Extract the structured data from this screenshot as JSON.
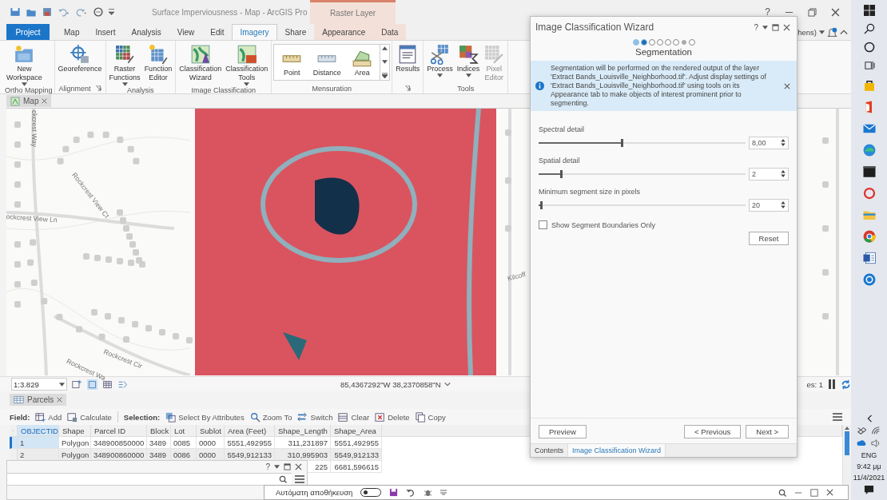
{
  "window": {
    "title": "Surface Imperviousness - Map - ArcGIS Pro",
    "context_title": "Raster Layer",
    "help": "?"
  },
  "ribbon_tabs": [
    {
      "label": "Project",
      "kind": "backstage",
      "selected": false
    },
    {
      "label": "Map",
      "kind": "core",
      "selected": false
    },
    {
      "label": "Insert",
      "kind": "core",
      "selected": false
    },
    {
      "label": "Analysis",
      "kind": "core",
      "selected": false
    },
    {
      "label": "View",
      "kind": "core",
      "selected": false
    },
    {
      "label": "Edit",
      "kind": "core",
      "selected": false
    },
    {
      "label": "Imagery",
      "kind": "core",
      "selected": true
    },
    {
      "label": "Share",
      "kind": "core",
      "selected": false
    },
    {
      "label": "Appearance",
      "kind": "contextual",
      "selected": false
    },
    {
      "label": "Data",
      "kind": "contextual",
      "selected": false
    }
  ],
  "account": {
    "text": "hens)"
  },
  "ribbon_groups": [
    {
      "label": "Ortho Mapping",
      "kind": "plain",
      "launcher": false,
      "buttons": [
        {
          "label": "New\nWorkspace",
          "dropdown": true,
          "disabled": false
        }
      ]
    },
    {
      "label": "Alignment",
      "kind": "plain",
      "launcher": true,
      "buttons": [
        {
          "label": "Georeference",
          "dropdown": false,
          "disabled": false
        }
      ]
    },
    {
      "label": "Analysis",
      "kind": "plain",
      "launcher": false,
      "buttons": [
        {
          "label": "Raster\nFunctions",
          "dropdown": true,
          "disabled": false
        },
        {
          "label": "Function\nEditor",
          "dropdown": false,
          "disabled": false
        }
      ]
    },
    {
      "label": "Image Classification",
      "kind": "plain",
      "launcher": false,
      "buttons": [
        {
          "label": "Classification\nWizard",
          "dropdown": false,
          "disabled": false
        },
        {
          "label": "Classification\nTools",
          "dropdown": true,
          "disabled": false
        }
      ]
    },
    {
      "label": "Mensuration",
      "kind": "gallery",
      "launcher": false,
      "buttons": [
        {
          "label": "Point",
          "dropdown": false,
          "disabled": false
        },
        {
          "label": "Distance",
          "dropdown": false,
          "disabled": false
        },
        {
          "label": "Area",
          "dropdown": false,
          "disabled": false
        }
      ]
    },
    {
      "kind": "plain",
      "launcher": true,
      "buttons": [
        {
          "label": "Results",
          "dropdown": false,
          "disabled": false
        }
      ]
    },
    {
      "label": "Tools",
      "kind": "plain",
      "launcher": false,
      "buttons": [
        {
          "label": "Process",
          "dropdown": true,
          "disabled": false
        },
        {
          "label": "Indices",
          "dropdown": true,
          "disabled": false
        },
        {
          "label": "Pixel\nEditor",
          "dropdown": false,
          "disabled": true
        }
      ]
    }
  ],
  "map_tab": {
    "label": "Map"
  },
  "map_labels": [
    {
      "text": "ckcrest Way"
    },
    {
      "text": "Rockcrest View Ct"
    },
    {
      "text": "ockcrest View Ln"
    },
    {
      "text": "Rockcrest Cir"
    },
    {
      "text": "Rockcrest Wa"
    },
    {
      "text": "Kilcoff"
    }
  ],
  "map_status": {
    "scale": "1:3.829",
    "coordinates": "85,4367292\"W 38,2370858\"N",
    "features": "es: 1"
  },
  "table": {
    "tab": "Parcels",
    "field_label": "Field:",
    "field_tools": [
      "Add",
      "Calculate"
    ],
    "selection_label": "Selection:",
    "selection_tools": [
      "Select By Attributes",
      "Zoom To",
      "Switch",
      "Clear",
      "Delete",
      "Copy"
    ],
    "columns": [
      "OBJECTID",
      "Shape",
      "Parcel ID",
      "Block",
      "Lot",
      "Sublot",
      "Area (Feet)",
      "Shape_Length",
      "Shape_Area"
    ],
    "rows": [
      {
        "selected": true,
        "cells": [
          "1",
          "Polygon",
          "348900850000",
          "3489",
          "0085",
          "0000",
          "5551,492955",
          "311,231897",
          "5551,492955"
        ]
      },
      {
        "selected": false,
        "cells": [
          "2",
          "Polygon",
          "348900860000",
          "3489",
          "0086",
          "0000",
          "5549,912133",
          "310,995903",
          "5549,912133"
        ]
      },
      {
        "cells": [
          null,
          null,
          null,
          null,
          null,
          null,
          null,
          "225",
          "6681,596615"
        ]
      }
    ]
  },
  "wizard": {
    "title": "Image Classification Wizard",
    "help": "?",
    "steps": [
      {
        "completed": true,
        "selected": false,
        "optional": false
      },
      {
        "completed": true,
        "selected": true,
        "optional": false
      },
      {
        "completed": false,
        "selected": false,
        "optional": false
      },
      {
        "completed": false,
        "selected": false,
        "optional": false
      },
      {
        "completed": false,
        "selected": false,
        "optional": false
      },
      {
        "completed": false,
        "selected": false,
        "optional": false
      },
      {
        "completed": false,
        "selected": false,
        "optional": true
      },
      {
        "completed": false,
        "selected": false,
        "optional": false
      }
    ],
    "step_title": "Segmentation",
    "info": "Segmentation will be performed on the rendered output of the layer 'Extract Bands_Louisville_Neighborhood.tif'. Adjust display settings of 'Extract Bands_Louisville_Neighborhood.tif' using tools on its Appearance tab to make objects of interest prominent prior to segmenting.",
    "parameters": [
      {
        "label": "Spectral detail",
        "level": 0.4,
        "value": "8,00"
      },
      {
        "label": "Spatial detail",
        "level": 0.11,
        "value": "2"
      },
      {
        "label": "Minimum segment size in pixels",
        "level": 0.01,
        "value": "20"
      }
    ],
    "checkbox": {
      "label": "Show Segment Boundaries Only",
      "checked": false
    },
    "reset": "Reset",
    "preview": "Preview",
    "previous": "< Previous",
    "next": "Next >",
    "tabs": [
      {
        "label": "Contents",
        "selected": false
      },
      {
        "label": "Image Classification Wizard",
        "selected": true
      }
    ]
  },
  "float_pane": {
    "help": "?"
  },
  "autosave": {
    "label": "Αυτόματη αποθήκευση",
    "on": false
  },
  "tray": {
    "language": "ENG",
    "time": "9:42 μμ",
    "date": "11/4/2021"
  }
}
